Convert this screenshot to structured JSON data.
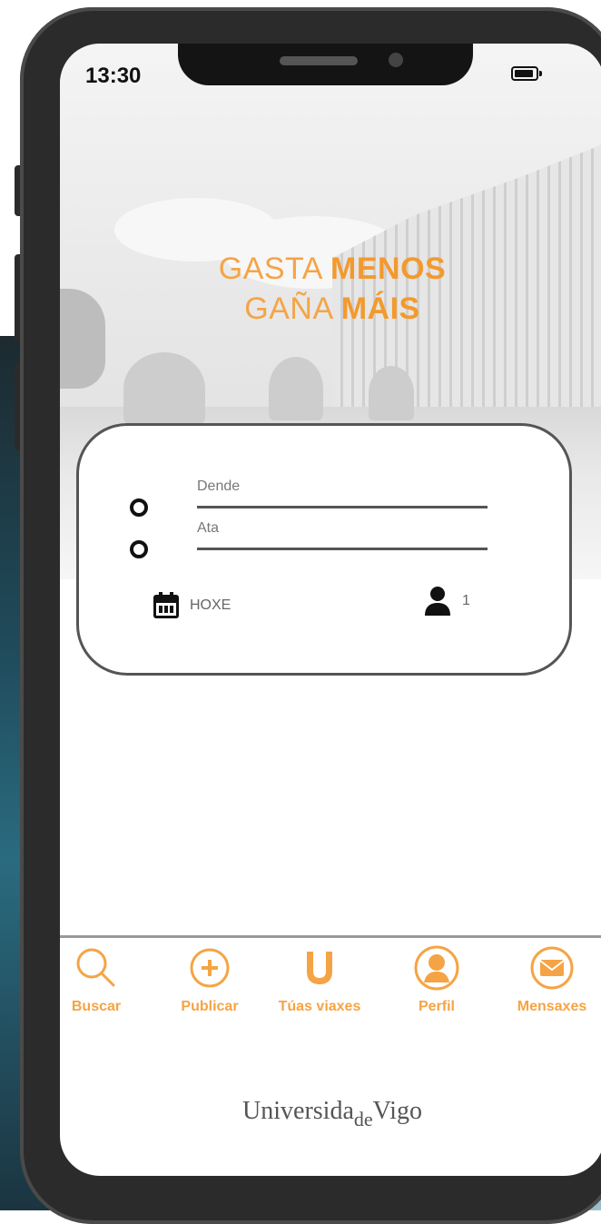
{
  "status": {
    "time": "13:30"
  },
  "hero": {
    "line1_prefix": "GASTA ",
    "line1_bold": "MENOS",
    "line2_prefix": "GAÑA ",
    "line2_bold": "MÁIS"
  },
  "search": {
    "from_label": "Dende",
    "to_label": "Ata",
    "date_value": "HOXE",
    "passengers": "1"
  },
  "nav": {
    "items": [
      {
        "label": "Buscar",
        "icon": "search-icon"
      },
      {
        "label": "Publicar",
        "icon": "plus-circle-icon"
      },
      {
        "label": "Túas viaxes",
        "icon": "u-logo-icon"
      },
      {
        "label": "Perfil",
        "icon": "profile-icon"
      },
      {
        "label": "Mensaxes",
        "icon": "mail-icon"
      }
    ]
  },
  "brand": {
    "part1": "Universida",
    "part2": "de",
    "part3": "Vigo"
  },
  "colors": {
    "accent": "#f5a445",
    "frame": "#2b2b2b"
  }
}
